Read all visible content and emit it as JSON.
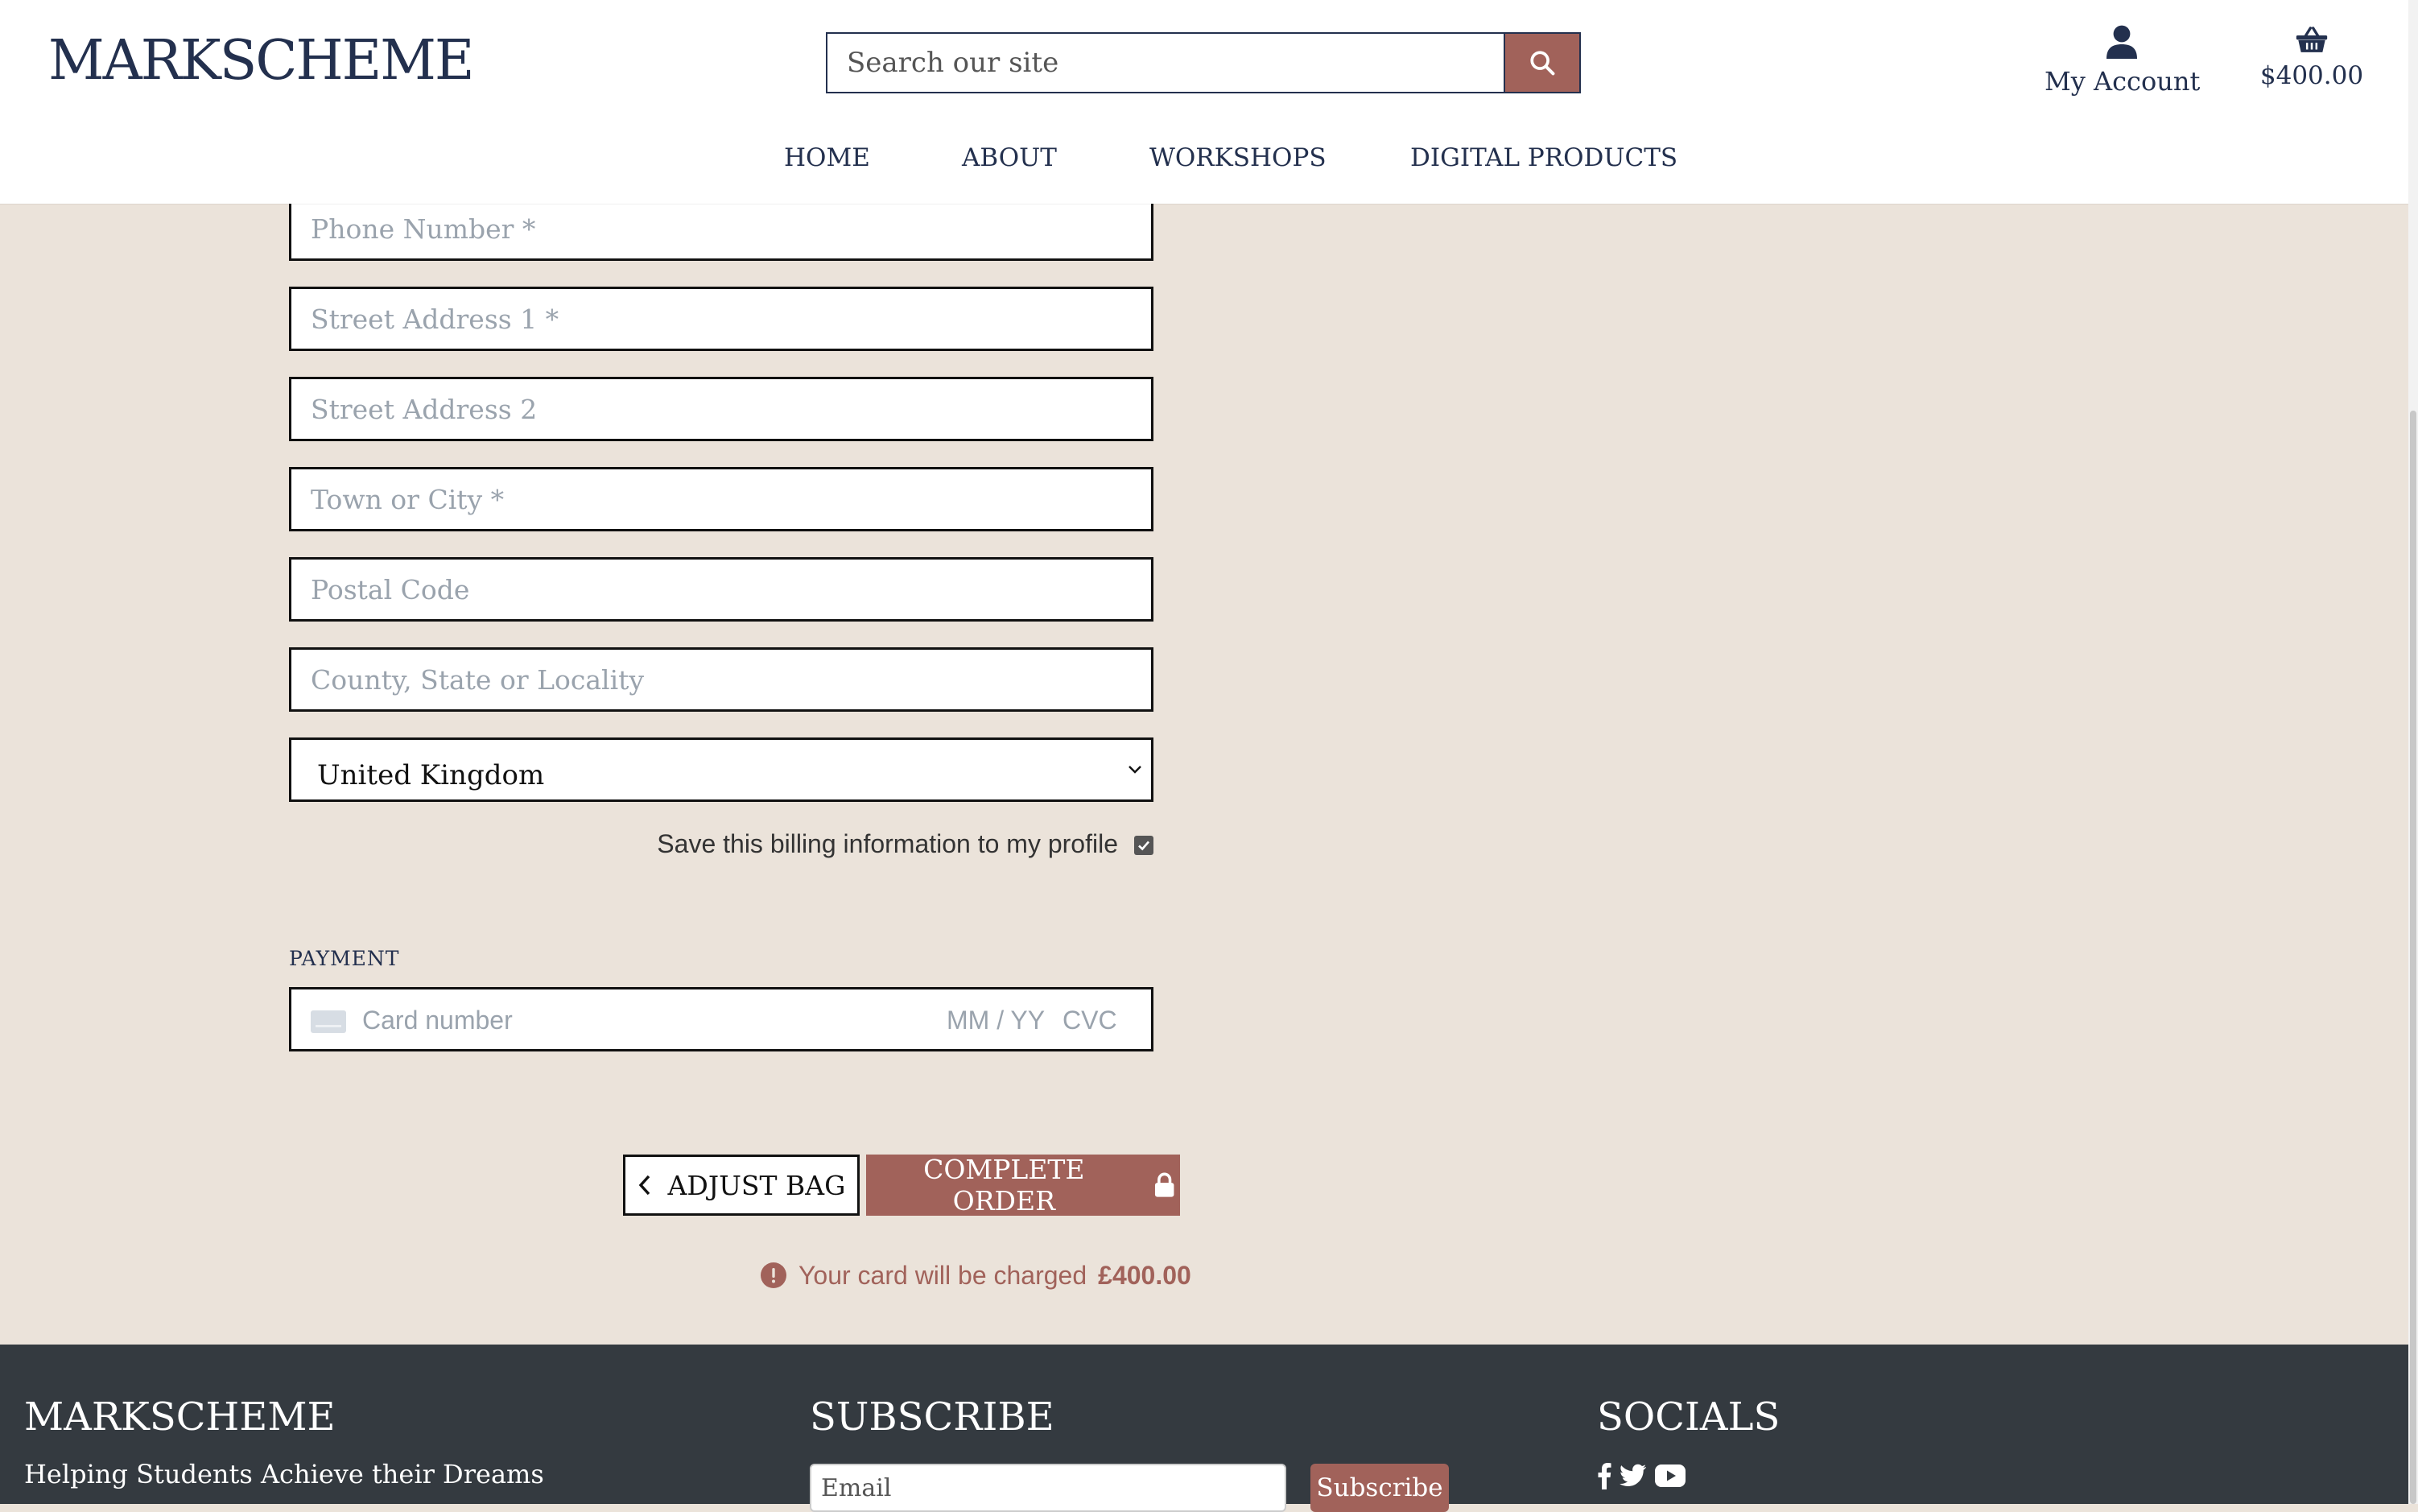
{
  "header": {
    "logo": "MARKSCHEME",
    "search_placeholder": "Search our site",
    "account_label": "My Account",
    "cart_total": "$400.00"
  },
  "nav": {
    "items": [
      {
        "label": "HOME"
      },
      {
        "label": "ABOUT"
      },
      {
        "label": "WORKSHOPS"
      },
      {
        "label": "DIGITAL PRODUCTS"
      }
    ]
  },
  "form": {
    "phone_placeholder": "Phone Number *",
    "street1_placeholder": "Street Address 1 *",
    "street2_placeholder": "Street Address 2",
    "town_placeholder": "Town or City *",
    "postal_placeholder": "Postal Code",
    "county_placeholder": "County, State or Locality",
    "country_selected": "United Kingdom",
    "save_label": "Save this billing information to my profile",
    "save_checked": true
  },
  "payment": {
    "label": "PAYMENT",
    "card_placeholder": "Card number",
    "expiry_placeholder": "MM / YY",
    "cvc_placeholder": "CVC"
  },
  "actions": {
    "adjust_label": "ADJUST BAG",
    "complete_label": "COMPLETE ORDER",
    "charge_prefix": "Your card will be charged",
    "charge_amount": "£400.00"
  },
  "footer": {
    "brand": "MARKSCHEME",
    "tagline": "Helping Students Achieve their Dreams",
    "subscribe_title": "SUBSCRIBE",
    "email_placeholder": "Email",
    "subscribe_button": "Subscribe",
    "socials_title": "SOCIALS",
    "social_icons": [
      "facebook-icon",
      "twitter-icon",
      "youtube-icon"
    ]
  },
  "colors": {
    "brand_navy": "#23304e",
    "accent": "#a1625a",
    "page_bg": "#ebe3da",
    "footer_bg": "#343a40"
  }
}
